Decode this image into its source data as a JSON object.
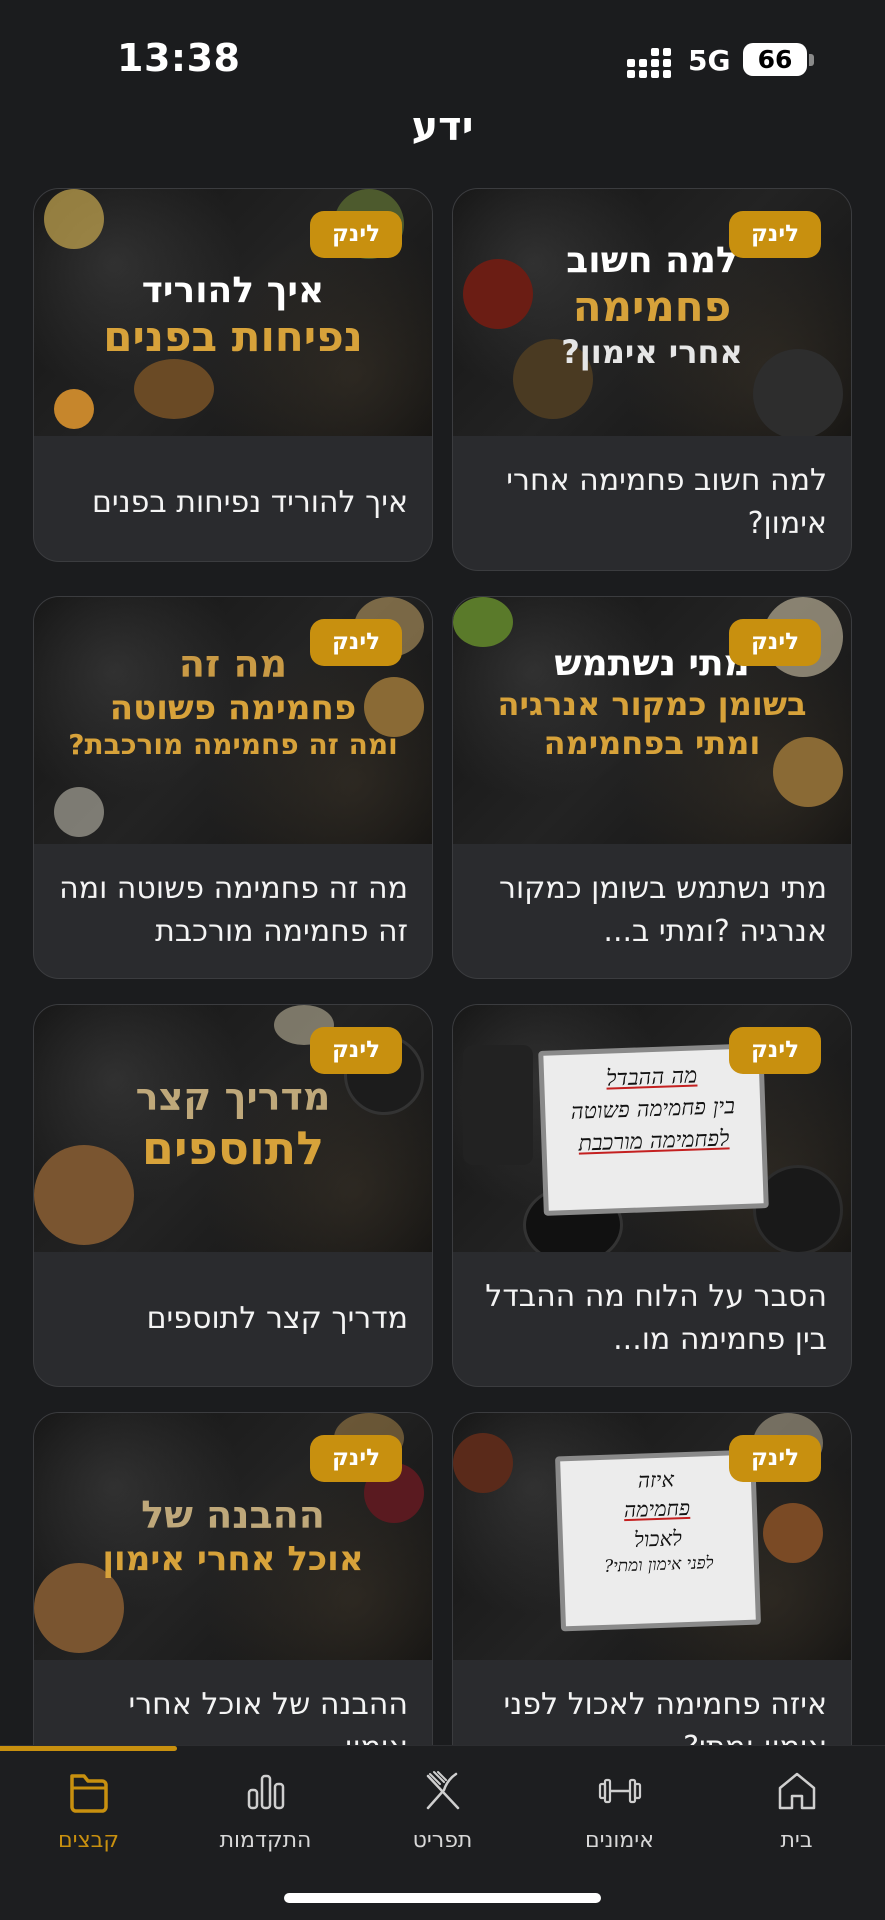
{
  "status_bar": {
    "time": "13:38",
    "network": "5G",
    "battery": "66"
  },
  "header": {
    "title": "ידע"
  },
  "badge_label": "לינק",
  "cards": [
    {
      "title": "למה חשוב פחמימה אחרי אימון?",
      "thumb": [
        "למה חשוב",
        "פחמימה",
        "אחרי אימון?"
      ]
    },
    {
      "title": "איך להוריד נפיחות בפנים",
      "thumb": [
        "איך להוריד",
        "נפיחות בפנים"
      ]
    },
    {
      "title": "מתי נשתמש בשומן כמקור אנרגיה ?ומתי ב...",
      "thumb": [
        "מתי נשתמש",
        "בשומן כמקור אנרגיה",
        "ומתי בפחמימה"
      ]
    },
    {
      "title": "מה זה פחמימה פשוטה ומה זה פחמימה מורכבת",
      "thumb": [
        "מה זה",
        "פחמימה פשוטה",
        "ומה זה פחמימה מורכבת?"
      ]
    },
    {
      "title": "הסבר על הלוח מה ההבדל בין פחמימה מו...",
      "whiteboard": [
        "מה ההבדל",
        "בין פחמימה פשוטה",
        "לפחמימה מורכבת"
      ]
    },
    {
      "title": "מדריך קצר לתוספים",
      "thumb": [
        "מדריך קצר",
        "לתוספים"
      ]
    },
    {
      "title": "איזה פחמימה לאכול לפני אימון ומתי?",
      "whiteboard": [
        "איזה",
        "פחמימה",
        "לאכול",
        "לפני אימון ומתי?"
      ]
    },
    {
      "title": "ההבנה של אוכל אחרי אימון",
      "thumb": [
        "ההבנה של",
        "אוכל אחרי אימון"
      ]
    }
  ],
  "nav": {
    "items": [
      {
        "label": "בית",
        "icon": "home-icon"
      },
      {
        "label": "אימונים",
        "icon": "dumbbell-icon"
      },
      {
        "label": "תפריט",
        "icon": "fork-knife-icon"
      },
      {
        "label": "התקדמות",
        "icon": "bar-chart-icon"
      },
      {
        "label": "קבצים",
        "icon": "folder-icon",
        "active": true
      }
    ],
    "accent": "#c8900f"
  }
}
